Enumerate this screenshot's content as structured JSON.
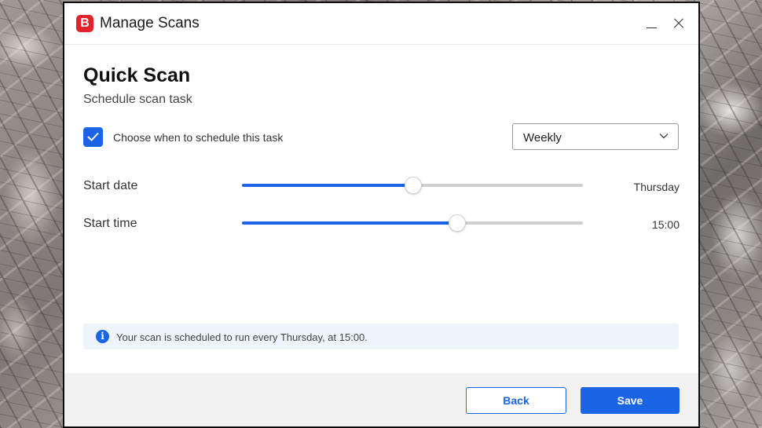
{
  "window": {
    "title": "Manage Scans",
    "logo_letter": "B",
    "brand_color": "#e3232c",
    "accent_color": "#1a64e6"
  },
  "page": {
    "heading": "Quick Scan",
    "subheading": "Schedule scan task"
  },
  "schedule": {
    "checkbox_checked": true,
    "checkbox_label": "Choose when to schedule this task",
    "frequency": "Weekly"
  },
  "sliders": {
    "start_date": {
      "label": "Start date",
      "value": "Thursday",
      "fraction": 0.5
    },
    "start_time": {
      "label": "Start time",
      "value": "15:00",
      "fraction": 0.63
    }
  },
  "info": {
    "icon": "info-icon",
    "text": "Your scan is scheduled to run every Thursday, at 15:00."
  },
  "footer": {
    "back_label": "Back",
    "save_label": "Save"
  }
}
